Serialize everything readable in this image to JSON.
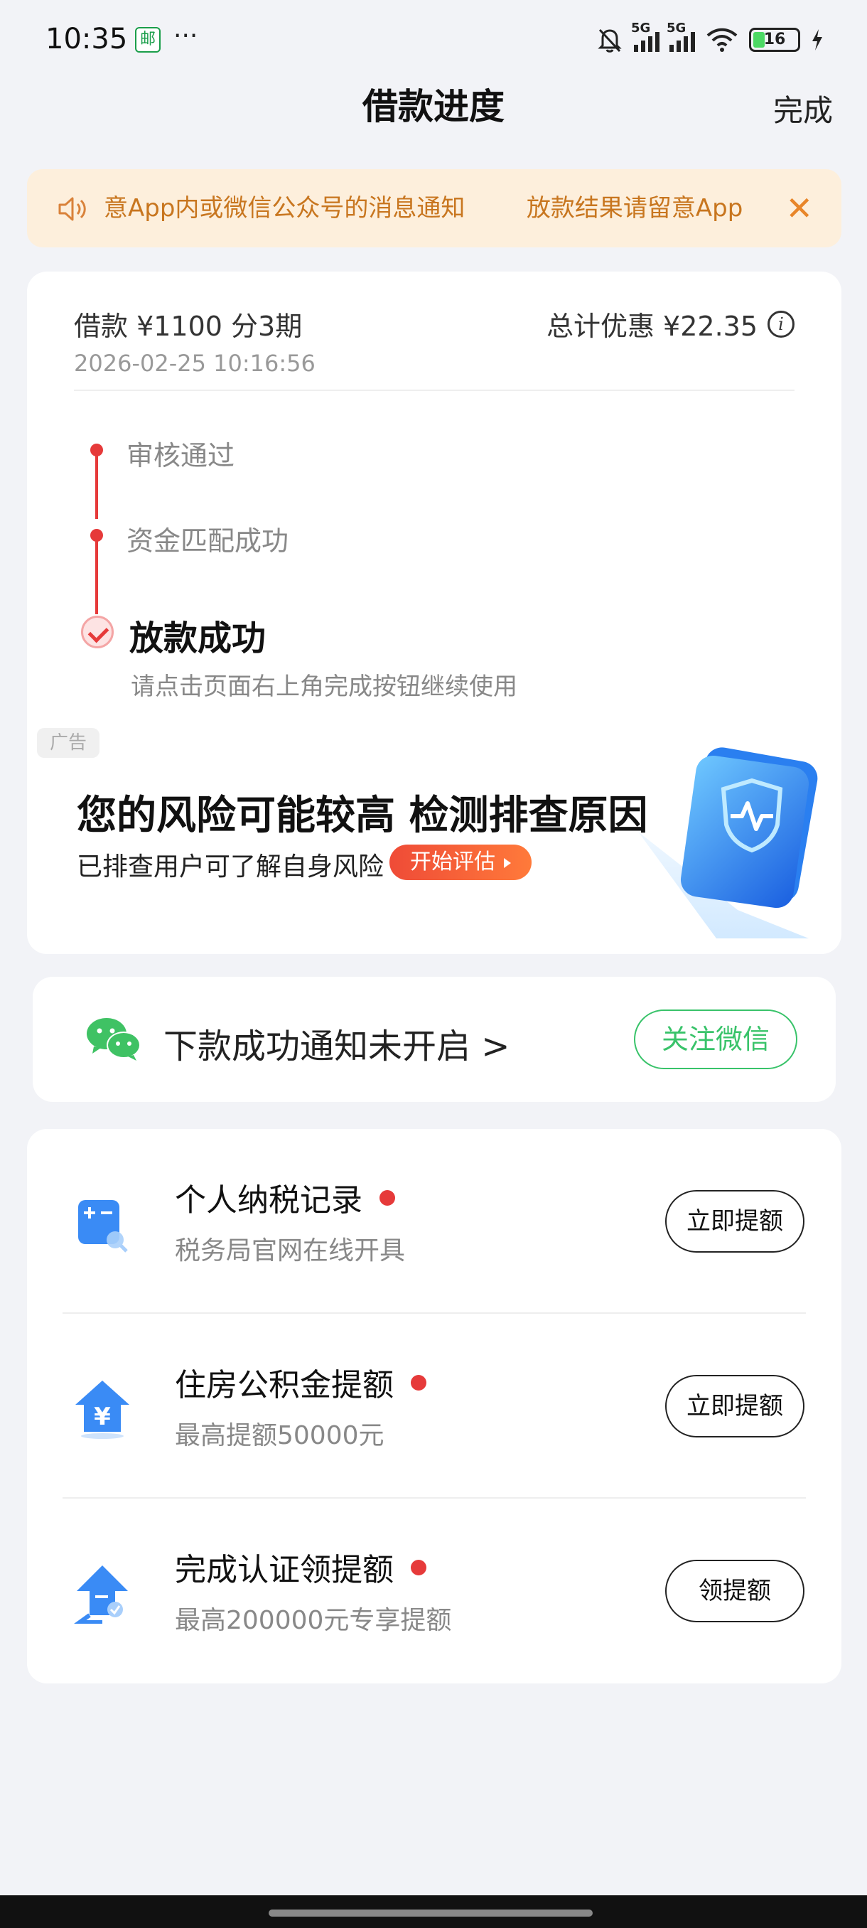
{
  "status_bar": {
    "time": "10:35",
    "app_icon_glyph": "邮",
    "more": "···",
    "network_1": "5G",
    "network_2": "5G",
    "battery": "16"
  },
  "nav": {
    "title": "借款进度",
    "done": "完成"
  },
  "notice": {
    "text": "意App内或微信公众号的消息通知        放款结果请留意App",
    "icon": "speaker-icon",
    "close": "✕",
    "color": "#c8761f"
  },
  "loan": {
    "summary": "借款 ¥1100  分3期",
    "discount": "总计优惠 ¥22.35",
    "info": "i",
    "datetime": "2026-02-25 10:16:56"
  },
  "progress": {
    "steps": [
      {
        "label": "审核通过"
      },
      {
        "label": "资金匹配成功"
      }
    ],
    "final": {
      "label": "放款成功",
      "hint": "请点击页面右上角完成按钮继续使用"
    },
    "accent": "#e63a3a"
  },
  "ad": {
    "tag": "广告",
    "title": "您的风险可能较高 检测排查原因",
    "subtitle": "已排查用户可了解自身风险",
    "button": "开始评估",
    "illustration": "shield-wallet-illustration"
  },
  "wechat": {
    "text": "下款成功通知未开启 >",
    "button": "关注微信",
    "color": "#39c36a"
  },
  "list": [
    {
      "title": "个人纳税记录",
      "subtitle": "税务局官网在线开具",
      "button": "立即提额",
      "icon": "calculator-icon"
    },
    {
      "title": "住房公积金提额",
      "subtitle": "最高提额50000元",
      "button": "立即提额",
      "icon": "house-yuan-icon"
    },
    {
      "title": "完成认证领提额",
      "subtitle": "最高200000元专享提额",
      "button": "领提额",
      "icon": "verify-upload-icon"
    }
  ]
}
